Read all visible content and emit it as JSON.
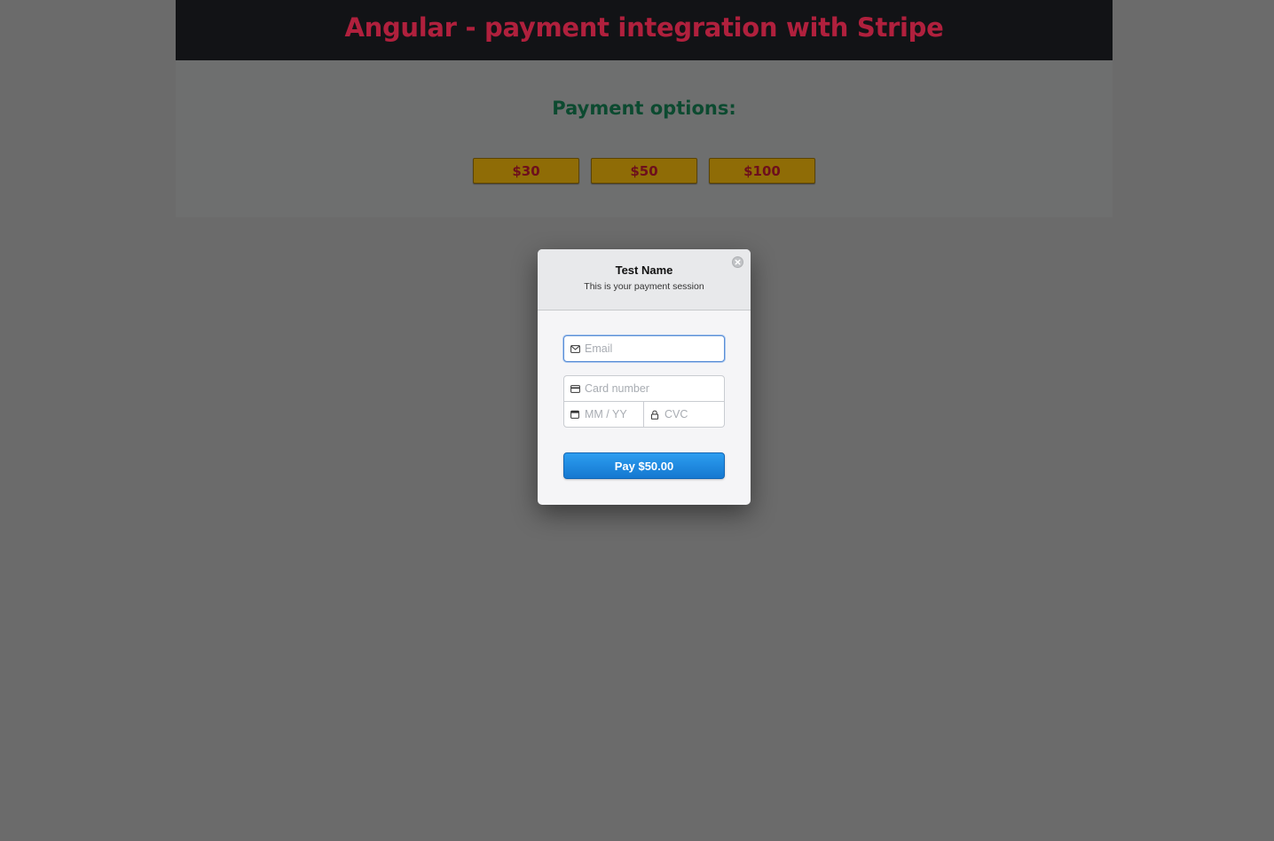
{
  "header": {
    "title": "Angular - payment integration with Stripe"
  },
  "options": {
    "heading": "Payment options:",
    "amounts": [
      {
        "label": "$30"
      },
      {
        "label": "$50"
      },
      {
        "label": "$100"
      }
    ]
  },
  "checkout": {
    "title": "Test Name",
    "subtitle": "This is your payment session",
    "email_placeholder": "Email",
    "card_placeholder": "Card number",
    "expiry_placeholder": "MM / YY",
    "cvc_placeholder": "CVC",
    "pay_label": "Pay $50.00"
  },
  "colors": {
    "header_bg": "#121316",
    "title_color": "#b0203d",
    "heading_color": "#0c4a30",
    "amount_button_bg": "#8f6c06",
    "pay_button": "#1f8ae0"
  },
  "icons": {
    "close": "close-icon",
    "email": "envelope-icon",
    "card": "credit-card-icon",
    "expiry": "calendar-icon",
    "cvc": "lock-icon"
  }
}
